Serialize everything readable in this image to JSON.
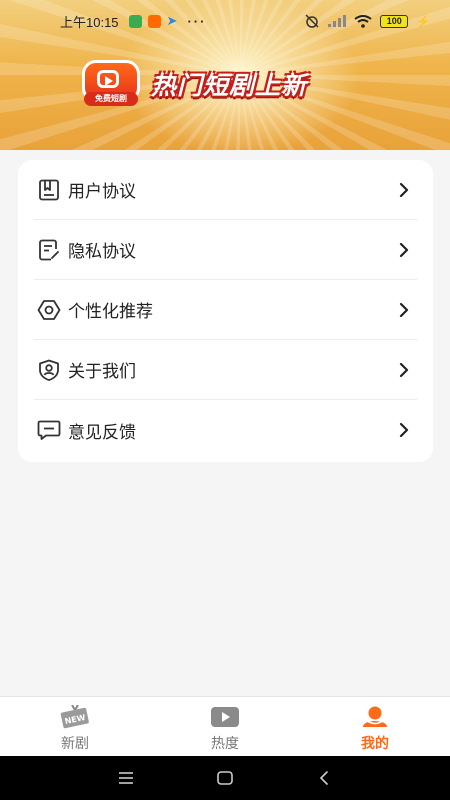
{
  "status_bar": {
    "time": "上午10:15",
    "dots": "···",
    "battery": "100"
  },
  "banner": {
    "logo_tag": "免费短剧",
    "title": "热门短剧上新"
  },
  "menu": {
    "items": [
      {
        "label": "用户协议",
        "icon": "document-icon"
      },
      {
        "label": "隐私协议",
        "icon": "privacy-doc-icon"
      },
      {
        "label": "个性化推荐",
        "icon": "gear-icon"
      },
      {
        "label": "关于我们",
        "icon": "user-shield-icon"
      },
      {
        "label": "意见反馈",
        "icon": "message-icon"
      }
    ]
  },
  "bottom_nav": {
    "items": [
      {
        "label": "新剧",
        "icon": "new-badge-icon",
        "active": false
      },
      {
        "label": "热度",
        "icon": "play-icon",
        "active": false
      },
      {
        "label": "我的",
        "icon": "profile-icon",
        "active": true
      }
    ]
  },
  "colors": {
    "accent": "#ff6a1a",
    "card_bg": "#ffffff",
    "page_bg": "#f5f5f5"
  }
}
